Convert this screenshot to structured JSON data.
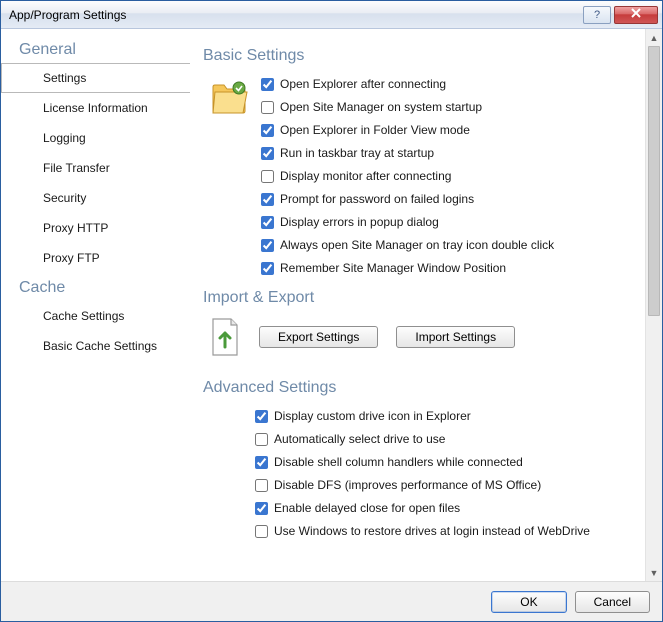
{
  "window": {
    "title": "App/Program Settings"
  },
  "sidebar": {
    "groups": [
      {
        "label": "General",
        "items": [
          {
            "label": "Settings",
            "active": true
          },
          {
            "label": "License Information",
            "active": false
          },
          {
            "label": "Logging",
            "active": false
          },
          {
            "label": "File Transfer",
            "active": false
          },
          {
            "label": "Security",
            "active": false
          },
          {
            "label": "Proxy HTTP",
            "active": false
          },
          {
            "label": "Proxy FTP",
            "active": false
          }
        ]
      },
      {
        "label": "Cache",
        "items": [
          {
            "label": "Cache Settings",
            "active": false
          },
          {
            "label": "Basic Cache Settings",
            "active": false
          }
        ]
      }
    ]
  },
  "sections": {
    "basic": {
      "title": "Basic Settings",
      "options": [
        {
          "label": "Open Explorer after connecting",
          "checked": true
        },
        {
          "label": "Open Site Manager on system startup",
          "checked": false
        },
        {
          "label": "Open Explorer in Folder View mode",
          "checked": true
        },
        {
          "label": "Run in taskbar tray at startup",
          "checked": true
        },
        {
          "label": "Display monitor after connecting",
          "checked": false
        },
        {
          "label": "Prompt for password on failed logins",
          "checked": true
        },
        {
          "label": "Display errors in popup dialog",
          "checked": true
        },
        {
          "label": "Always open Site Manager on tray icon double click",
          "checked": true
        },
        {
          "label": "Remember Site Manager Window Position",
          "checked": true
        }
      ]
    },
    "import_export": {
      "title": "Import & Export",
      "export_btn": "Export Settings",
      "import_btn": "Import Settings"
    },
    "advanced": {
      "title": "Advanced Settings",
      "options": [
        {
          "label": "Display custom drive icon in Explorer",
          "checked": true
        },
        {
          "label": "Automatically select drive to use",
          "checked": false
        },
        {
          "label": "Disable shell column handlers while connected",
          "checked": true
        },
        {
          "label": "Disable DFS (improves performance of MS Office)",
          "checked": false
        },
        {
          "label": "Enable delayed close for open files",
          "checked": true
        },
        {
          "label": "Use Windows to restore drives at login instead of WebDrive",
          "checked": false
        }
      ]
    }
  },
  "footer": {
    "ok": "OK",
    "cancel": "Cancel"
  }
}
